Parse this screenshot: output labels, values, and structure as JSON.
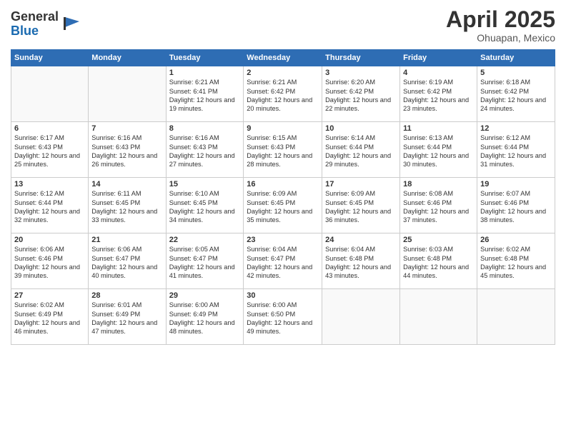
{
  "logo": {
    "general": "General",
    "blue": "Blue"
  },
  "header": {
    "month": "April 2025",
    "location": "Ohuapan, Mexico"
  },
  "weekdays": [
    "Sunday",
    "Monday",
    "Tuesday",
    "Wednesday",
    "Thursday",
    "Friday",
    "Saturday"
  ],
  "weeks": [
    [
      {
        "day": "",
        "info": ""
      },
      {
        "day": "",
        "info": ""
      },
      {
        "day": "1",
        "info": "Sunrise: 6:21 AM\nSunset: 6:41 PM\nDaylight: 12 hours and 19 minutes."
      },
      {
        "day": "2",
        "info": "Sunrise: 6:21 AM\nSunset: 6:42 PM\nDaylight: 12 hours and 20 minutes."
      },
      {
        "day": "3",
        "info": "Sunrise: 6:20 AM\nSunset: 6:42 PM\nDaylight: 12 hours and 22 minutes."
      },
      {
        "day": "4",
        "info": "Sunrise: 6:19 AM\nSunset: 6:42 PM\nDaylight: 12 hours and 23 minutes."
      },
      {
        "day": "5",
        "info": "Sunrise: 6:18 AM\nSunset: 6:42 PM\nDaylight: 12 hours and 24 minutes."
      }
    ],
    [
      {
        "day": "6",
        "info": "Sunrise: 6:17 AM\nSunset: 6:43 PM\nDaylight: 12 hours and 25 minutes."
      },
      {
        "day": "7",
        "info": "Sunrise: 6:16 AM\nSunset: 6:43 PM\nDaylight: 12 hours and 26 minutes."
      },
      {
        "day": "8",
        "info": "Sunrise: 6:16 AM\nSunset: 6:43 PM\nDaylight: 12 hours and 27 minutes."
      },
      {
        "day": "9",
        "info": "Sunrise: 6:15 AM\nSunset: 6:43 PM\nDaylight: 12 hours and 28 minutes."
      },
      {
        "day": "10",
        "info": "Sunrise: 6:14 AM\nSunset: 6:44 PM\nDaylight: 12 hours and 29 minutes."
      },
      {
        "day": "11",
        "info": "Sunrise: 6:13 AM\nSunset: 6:44 PM\nDaylight: 12 hours and 30 minutes."
      },
      {
        "day": "12",
        "info": "Sunrise: 6:12 AM\nSunset: 6:44 PM\nDaylight: 12 hours and 31 minutes."
      }
    ],
    [
      {
        "day": "13",
        "info": "Sunrise: 6:12 AM\nSunset: 6:44 PM\nDaylight: 12 hours and 32 minutes."
      },
      {
        "day": "14",
        "info": "Sunrise: 6:11 AM\nSunset: 6:45 PM\nDaylight: 12 hours and 33 minutes."
      },
      {
        "day": "15",
        "info": "Sunrise: 6:10 AM\nSunset: 6:45 PM\nDaylight: 12 hours and 34 minutes."
      },
      {
        "day": "16",
        "info": "Sunrise: 6:09 AM\nSunset: 6:45 PM\nDaylight: 12 hours and 35 minutes."
      },
      {
        "day": "17",
        "info": "Sunrise: 6:09 AM\nSunset: 6:45 PM\nDaylight: 12 hours and 36 minutes."
      },
      {
        "day": "18",
        "info": "Sunrise: 6:08 AM\nSunset: 6:46 PM\nDaylight: 12 hours and 37 minutes."
      },
      {
        "day": "19",
        "info": "Sunrise: 6:07 AM\nSunset: 6:46 PM\nDaylight: 12 hours and 38 minutes."
      }
    ],
    [
      {
        "day": "20",
        "info": "Sunrise: 6:06 AM\nSunset: 6:46 PM\nDaylight: 12 hours and 39 minutes."
      },
      {
        "day": "21",
        "info": "Sunrise: 6:06 AM\nSunset: 6:47 PM\nDaylight: 12 hours and 40 minutes."
      },
      {
        "day": "22",
        "info": "Sunrise: 6:05 AM\nSunset: 6:47 PM\nDaylight: 12 hours and 41 minutes."
      },
      {
        "day": "23",
        "info": "Sunrise: 6:04 AM\nSunset: 6:47 PM\nDaylight: 12 hours and 42 minutes."
      },
      {
        "day": "24",
        "info": "Sunrise: 6:04 AM\nSunset: 6:48 PM\nDaylight: 12 hours and 43 minutes."
      },
      {
        "day": "25",
        "info": "Sunrise: 6:03 AM\nSunset: 6:48 PM\nDaylight: 12 hours and 44 minutes."
      },
      {
        "day": "26",
        "info": "Sunrise: 6:02 AM\nSunset: 6:48 PM\nDaylight: 12 hours and 45 minutes."
      }
    ],
    [
      {
        "day": "27",
        "info": "Sunrise: 6:02 AM\nSunset: 6:49 PM\nDaylight: 12 hours and 46 minutes."
      },
      {
        "day": "28",
        "info": "Sunrise: 6:01 AM\nSunset: 6:49 PM\nDaylight: 12 hours and 47 minutes."
      },
      {
        "day": "29",
        "info": "Sunrise: 6:00 AM\nSunset: 6:49 PM\nDaylight: 12 hours and 48 minutes."
      },
      {
        "day": "30",
        "info": "Sunrise: 6:00 AM\nSunset: 6:50 PM\nDaylight: 12 hours and 49 minutes."
      },
      {
        "day": "",
        "info": ""
      },
      {
        "day": "",
        "info": ""
      },
      {
        "day": "",
        "info": ""
      }
    ]
  ],
  "colors": {
    "header_bg": "#2e6db4",
    "accent": "#1a6ab0"
  }
}
